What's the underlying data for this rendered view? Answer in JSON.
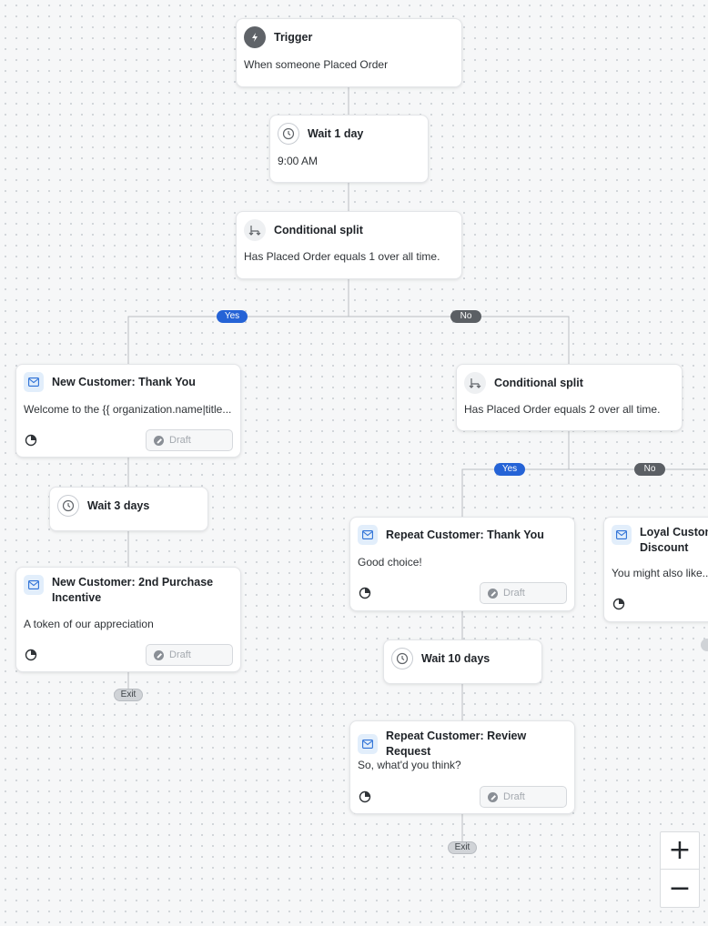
{
  "trigger": {
    "title": "Trigger",
    "desc": "When someone Placed Order"
  },
  "wait1": {
    "title": "Wait 1 day",
    "desc": "9:00 AM"
  },
  "split1": {
    "title": "Conditional split",
    "desc": "Has Placed Order equals 1 over all time."
  },
  "split1_yes": "Yes",
  "split1_no": "No",
  "new_thank": {
    "title": "New Customer: Thank You",
    "desc": "Welcome to the {{ organization.name|title...",
    "status": "Draft"
  },
  "wait3": {
    "title": "Wait 3 days"
  },
  "new_incentive": {
    "title_line1": "New Customer: 2nd Purchase",
    "title_line2": "Incentive",
    "desc": "A token of our appreciation",
    "status": "Draft"
  },
  "exit_left": "Exit",
  "split2": {
    "title": "Conditional split",
    "desc": "Has Placed Order equals 2 over all time."
  },
  "split2_yes": "Yes",
  "split2_no": "No",
  "repeat_thank": {
    "title": "Repeat Customer: Thank You",
    "desc": "Good choice!",
    "status": "Draft"
  },
  "wait10": {
    "title": "Wait 10 days"
  },
  "repeat_review": {
    "title": "Repeat Customer: Review Request",
    "desc": "So, what'd you think?",
    "status": "Draft"
  },
  "exit_right": "Exit",
  "loyal": {
    "title_line1": "Loyal Custom",
    "title_line2": "Discount",
    "desc": "You might also like..."
  },
  "zoom": {
    "in_label": "+",
    "out_label": "−"
  }
}
